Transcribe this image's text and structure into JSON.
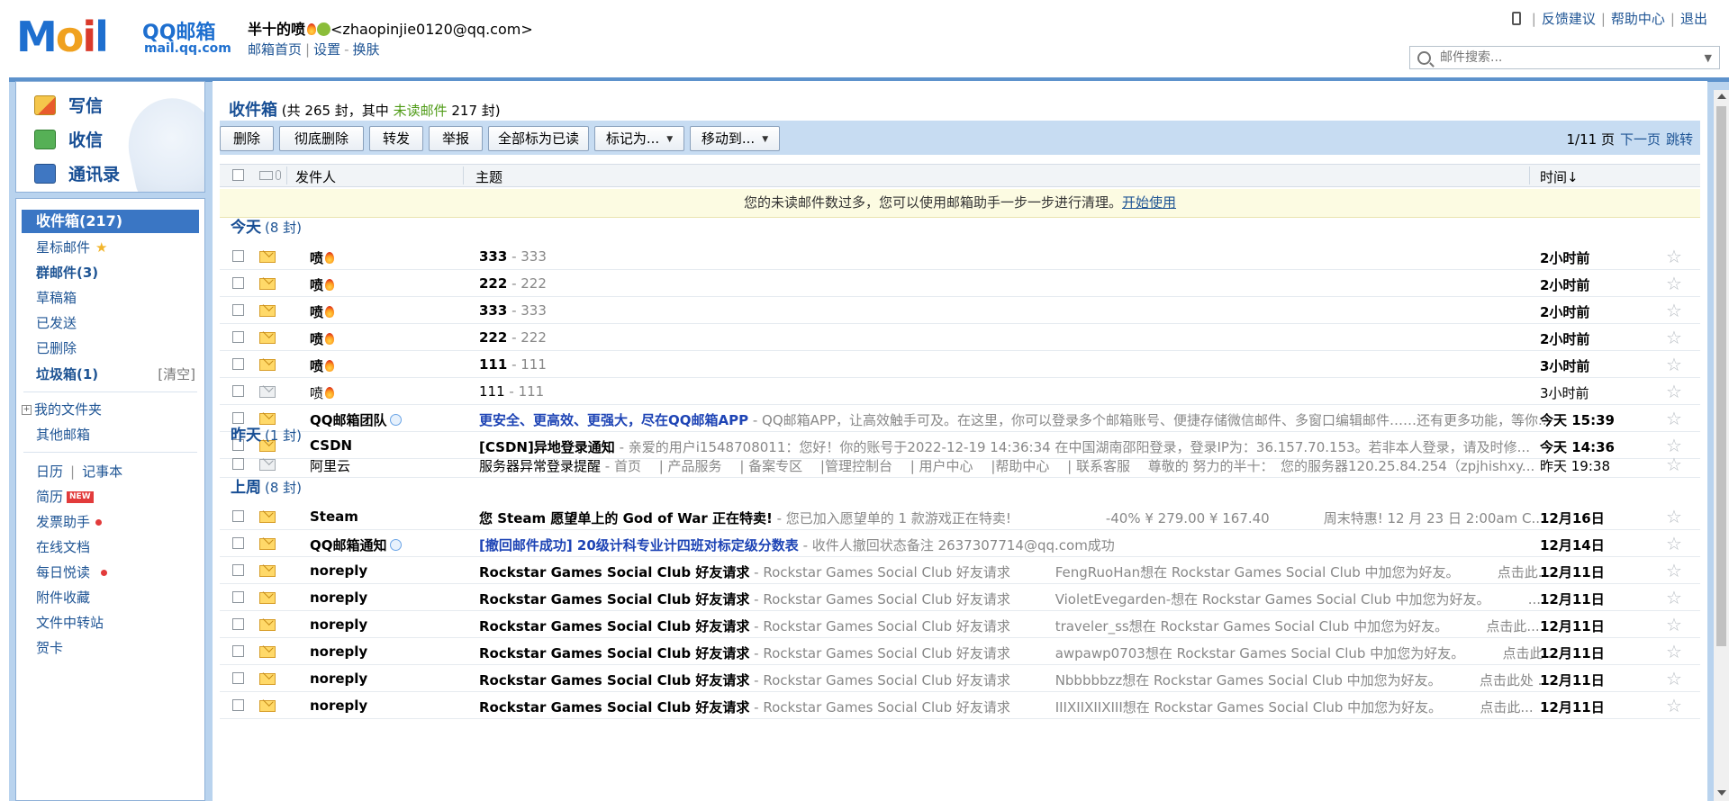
{
  "header": {
    "logo_letters": "Mail",
    "logo_brand": "QQ邮箱",
    "logo_domain": "mail.qq.com",
    "nickname": "半十的喷",
    "email": "<zhaopinjie0120@qq.com>",
    "links": {
      "home": "邮箱首页",
      "settings": "设置",
      "dash": "-",
      "skin": "换肤"
    },
    "top_links": {
      "feedback": "反馈建议",
      "help": "帮助中心",
      "logout": "退出"
    },
    "search_placeholder": "邮件搜索..."
  },
  "quick": {
    "write": "写信",
    "receive": "收信",
    "contacts": "通讯录"
  },
  "sidebar": {
    "inbox": "收件箱(217)",
    "starred": "星标邮件",
    "group": "群邮件(3)",
    "drafts": "草稿箱",
    "sent": "已发送",
    "deleted": "已删除",
    "spam": "垃圾箱(1)",
    "spam_clear": "[清空]",
    "my_folders": "我的文件夹",
    "other_mailboxes": "其他邮箱",
    "calendar": "日历",
    "notes": "记事本",
    "resume": "简历",
    "resume_badge": "NEW",
    "invoice": "发票助手",
    "docs": "在线文档",
    "daily": "每日悦读",
    "attachments": "附件收藏",
    "transfer": "文件中转站",
    "cards": "贺卡"
  },
  "main": {
    "title": "收件箱",
    "summary_pre": "(共 265 封，其中 ",
    "summary_unread": "未读邮件",
    "summary_post": " 217 封)",
    "toolbar": {
      "delete": "删除",
      "purge": "彻底删除",
      "forward": "转发",
      "report": "举报",
      "mark_all_read": "全部标为已读",
      "mark_as": "标记为...",
      "move_to": "移动到..."
    },
    "pager": {
      "page": "1/11 页",
      "next": "下一页",
      "jump": "跳转"
    },
    "columns": {
      "from": "发件人",
      "subject": "主题",
      "time": "时间↓"
    },
    "tip": "您的未读邮件数过多，您可以使用邮箱助手一步一步进行清理。",
    "tip_link": "开始使用",
    "groups": {
      "today": {
        "label": "今天",
        "count": "(8 封)"
      },
      "yesterday": {
        "label": "昨天",
        "count": "(1 封)"
      },
      "lastweek": {
        "label": "上周",
        "count": "(8 封)"
      }
    },
    "rows_today": [
      {
        "from": "喷",
        "subject": "333",
        "digest": " - 333",
        "time": "2小时前"
      },
      {
        "from": "喷",
        "subject": "222",
        "digest": " - 222",
        "time": "2小时前"
      },
      {
        "from": "喷",
        "subject": "333",
        "digest": " - 333",
        "time": "2小时前"
      },
      {
        "from": "喷",
        "subject": "222",
        "digest": " - 222",
        "time": "2小时前"
      },
      {
        "from": "喷",
        "subject": "111",
        "digest": " - 111",
        "time": "3小时前"
      },
      {
        "from": "喷",
        "subject": "111",
        "digest": " - 111",
        "time": "3小时前"
      },
      {
        "from": "QQ邮箱团队",
        "subject": "更安全、更高效、更强大，尽在QQ邮箱APP",
        "digest": " - QQ邮箱APP，让高效触手可及。在这里，你可以登录多个邮箱账号、便捷存储微信邮件、多窗口编辑邮件……还有更多功能，等你...",
        "time": "今天 15:39"
      },
      {
        "from": "CSDN",
        "subject": "[CSDN]异地登录通知",
        "digest": " - 亲爱的用户i1548708011：您好！你的账号于2022-12-19 14:36:34 在中国湖南邵阳登录，登录IP为：36.157.70.153。若非本人登录，请及时修...",
        "time": "今天 14:36"
      }
    ],
    "rows_yesterday": [
      {
        "from": "阿里云",
        "subject": "服务器异常登录提醒",
        "digest": " - 首页　 | 产品服务　 | 备案专区　 |管理控制台　 | 用户中心　 |帮助中心　 | 联系客服　 尊敬的 努力的半十：　您的服务器120.25.84.254（zpjhishxy...",
        "time": "昨天 19:38"
      }
    ],
    "rows_lastweek": [
      {
        "from": "Steam",
        "subject": "您 Steam 愿望单上的 God of War 正在特卖!",
        "digest": " - 您已加入愿望单的 1 款游戏正在特卖!　　　　　　　-40% ¥ 279.00 ¥ 167.40　　　　周末特惠! 12 月 23 日 2:00am C...",
        "time": "12月16日"
      },
      {
        "from": "QQ邮箱通知",
        "subject": "[撤回邮件成功] 20级计科专业计四班对标定级分数表",
        "digest": " - 收件人撤回状态备注 2637307714@qq.com成功",
        "time": "12月14日"
      },
      {
        "from": "noreply",
        "subject": "Rockstar Games Social Club 好友请求",
        "digest": " - Rockstar Games Social Club 好友请求　　　 FengRuoHan想在 Rockstar Games Social Club 中加您为好友。　　　 点击此...",
        "time": "12月11日"
      },
      {
        "from": "noreply",
        "subject": "Rockstar Games Social Club 好友请求",
        "digest": " - Rockstar Games Social Club 好友请求　　　 VioletEvegarden-想在 Rockstar Games Social Club 中加您为好友。　　　 ...",
        "time": "12月11日"
      },
      {
        "from": "noreply",
        "subject": "Rockstar Games Social Club 好友请求",
        "digest": " - Rockstar Games Social Club 好友请求　　　 traveler_ss想在 Rockstar Games Social Club 中加您为好友。　　　 点击此...",
        "time": "12月11日"
      },
      {
        "from": "noreply",
        "subject": "Rockstar Games Social Club 好友请求",
        "digest": " - Rockstar Games Social Club 好友请求　　　 awpawp0703想在 Rockstar Games Social Club 中加您为好友。　　　 点击此...",
        "time": "12月11日"
      },
      {
        "from": "noreply",
        "subject": "Rockstar Games Social Club 好友请求",
        "digest": " - Rockstar Games Social Club 好友请求　　　 Nbbbbbzz想在 Rockstar Games Social Club 中加您为好友。　　　 点击此处 ...",
        "time": "12月11日"
      },
      {
        "from": "noreply",
        "subject": "Rockstar Games Social Club 好友请求",
        "digest": " - Rockstar Games Social Club 好友请求　　　 IIIXIIXIIXIII想在 Rockstar Games Social Club 中加您为好友。　　　 点击此...",
        "time": "12月11日"
      }
    ],
    "star_glyph": "☆"
  },
  "colors": {
    "accent": "#3a76c4",
    "frame": "#b9d3ee",
    "unread_green": "#4f9b16"
  }
}
